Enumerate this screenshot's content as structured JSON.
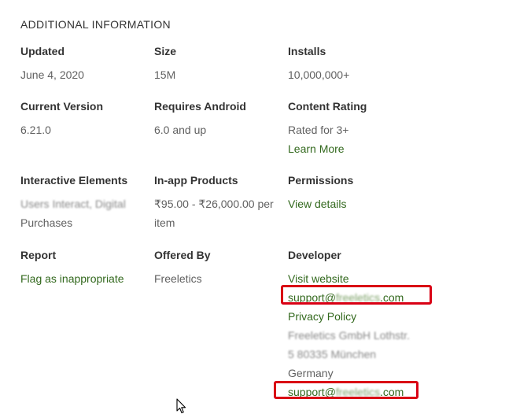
{
  "section_title": "ADDITIONAL INFORMATION",
  "updated": {
    "label": "Updated",
    "value": "June 4, 2020"
  },
  "size": {
    "label": "Size",
    "value": "15M"
  },
  "installs": {
    "label": "Installs",
    "value": "10,000,000+"
  },
  "current_version": {
    "label": "Current Version",
    "value": "6.21.0"
  },
  "requires_android": {
    "label": "Requires Android",
    "value": "6.0 and up"
  },
  "content_rating": {
    "label": "Content Rating",
    "value": "Rated for 3+",
    "link": "Learn More"
  },
  "interactive_elements": {
    "label": "Interactive Elements",
    "value_line1": "Users Interact, Digital",
    "value_line2": "Purchases"
  },
  "in_app_products": {
    "label": "In-app Products",
    "value_line1": "₹95.00 - ₹26,000.00 per",
    "value_line2": "item"
  },
  "permissions": {
    "label": "Permissions",
    "link": "View details"
  },
  "report": {
    "label": "Report",
    "link": "Flag as inappropriate"
  },
  "offered_by": {
    "label": "Offered By",
    "value": "Freeletics"
  },
  "developer": {
    "label": "Developer",
    "website": "Visit website",
    "email_prefix": "support@",
    "email_domain": "freeletics",
    "email_suffix": ".com",
    "privacy": "Privacy Policy",
    "address_line1": "Freeletics GmbH Lothstr.",
    "address_line2": "5 80335 München",
    "address_line3": "Germany"
  },
  "highlight_color": "#d90014",
  "link_color": "#33691e"
}
